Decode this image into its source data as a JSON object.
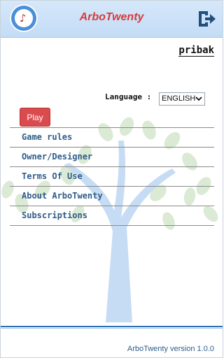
{
  "header": {
    "title": "ArboTwenty",
    "logo_icon": "arbotwenty-logo-icon",
    "exit_icon": "logout-icon",
    "accent_color": "#d93a39",
    "header_color": "#c3dcf6"
  },
  "user": {
    "name": "pribak"
  },
  "language": {
    "label": "Language :",
    "selected": "ENGLISH"
  },
  "play_label": "Play",
  "menu": {
    "items": [
      {
        "label": "Game rules"
      },
      {
        "label": "Owner/Designer"
      },
      {
        "label": "Terms Of Use"
      },
      {
        "label": "About ArboTwenty"
      },
      {
        "label": "Subscriptions"
      }
    ]
  },
  "footer": {
    "version": "ArboTwenty version 1.0.0"
  }
}
